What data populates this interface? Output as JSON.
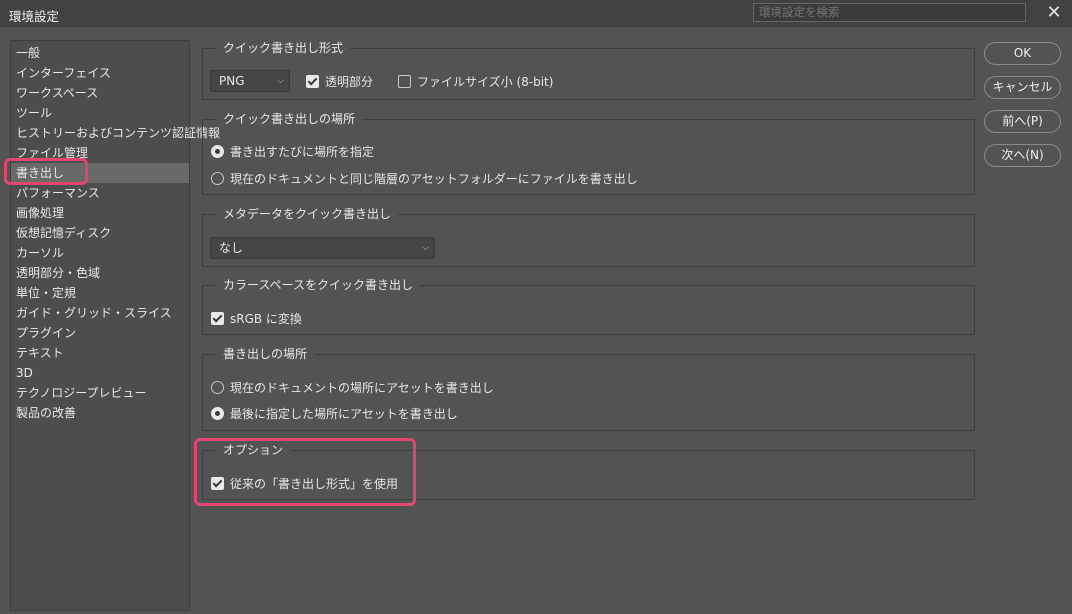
{
  "window": {
    "title": "環境設定",
    "search_placeholder": "環境設定を検索",
    "close_glyph": "✕"
  },
  "sidebar": {
    "items": [
      {
        "label": "一般"
      },
      {
        "label": "インターフェイス"
      },
      {
        "label": "ワークスペース"
      },
      {
        "label": "ツール"
      },
      {
        "label": "ヒストリーおよびコンテンツ認証情報"
      },
      {
        "label": "ファイル管理"
      },
      {
        "label": "書き出し",
        "selected": true
      },
      {
        "label": "パフォーマンス"
      },
      {
        "label": "画像処理"
      },
      {
        "label": "仮想記憶ディスク"
      },
      {
        "label": "カーソル"
      },
      {
        "label": "透明部分・色域"
      },
      {
        "label": "単位・定規"
      },
      {
        "label": "ガイド・グリッド・スライス"
      },
      {
        "label": "プラグイン"
      },
      {
        "label": "テキスト"
      },
      {
        "label": "3D"
      },
      {
        "label": "テクノロジープレビュー"
      },
      {
        "label": "製品の改善"
      }
    ]
  },
  "quick_export_format": {
    "title": "クイック書き出し形式",
    "format_value": "PNG",
    "transparency_label": "透明部分",
    "transparency_checked": true,
    "small_file_label": "ファイルサイズ小 (8-bit)",
    "small_file_checked": false
  },
  "quick_export_location": {
    "title": "クイック書き出しの場所",
    "option1": "書き出すたびに場所を指定",
    "option2": "現在のドキュメントと同じ階層のアセットフォルダーにファイルを書き出し",
    "selected": 1
  },
  "metadata": {
    "title": "メタデータをクイック書き出し",
    "value": "なし"
  },
  "color_space": {
    "title": "カラースペースをクイック書き出し",
    "srgb_label": "sRGB に変換",
    "srgb_checked": true
  },
  "export_location": {
    "title": "書き出しの場所",
    "option1": "現在のドキュメントの場所にアセットを書き出し",
    "option2": "最後に指定した場所にアセットを書き出し",
    "selected": 2
  },
  "options": {
    "title": "オプション",
    "legacy_label": "従来の「書き出し形式」を使用",
    "legacy_checked": true
  },
  "buttons": {
    "ok": "OK",
    "cancel": "キャンセル",
    "prev": "前へ(P)",
    "next": "次へ(N)"
  },
  "colors": {
    "highlight": "#e2466e",
    "background": "#535353"
  }
}
